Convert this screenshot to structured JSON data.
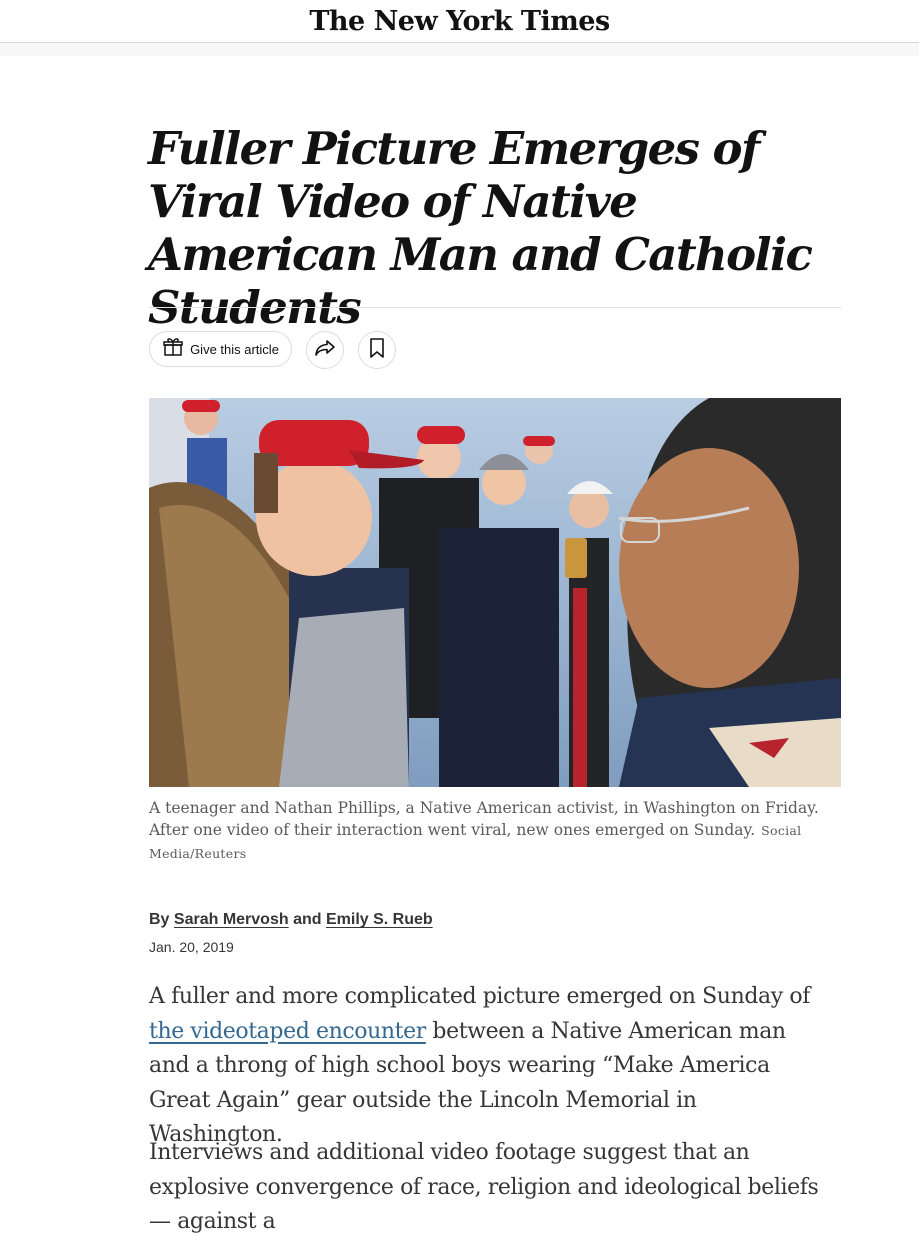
{
  "masthead": {
    "logo_text": "The New York Times"
  },
  "article": {
    "headline": "Fuller Picture Emerges of Viral Video of Native American Man and Catholic Students",
    "share": {
      "gift_label": "Give this article",
      "icons": [
        "gift-icon",
        "share-arrow-icon",
        "bookmark-icon"
      ]
    },
    "photo": {
      "caption": "A teenager and Nathan Phillips, a Native American activist, in Washington on Friday. After one video of their interaction went viral, new ones emerged on Sunday.",
      "credit": "Social Media/Reuters"
    },
    "byline": {
      "prefix": "By",
      "author1": "Sarah Mervosh",
      "conjunction": "and",
      "author2": "Emily S. Rueb"
    },
    "date": "Jan. 20, 2019",
    "paragraph1": {
      "before_link": "A fuller and more complicated picture emerged on Sunday of ",
      "link_text": "the videotaped encounter",
      "after_link": " between a Native American man and a throng of high school boys wearing “Make America Great Again” gear outside the Lincoln Memorial in Washington."
    },
    "paragraph2": "Interviews and additional video footage suggest that an explosive convergence of race, religion and ideological beliefs — against a"
  },
  "colors": {
    "link": "#326891",
    "text": "#363636",
    "caption": "#5a5a5a",
    "cap_red": "#d0202b"
  }
}
